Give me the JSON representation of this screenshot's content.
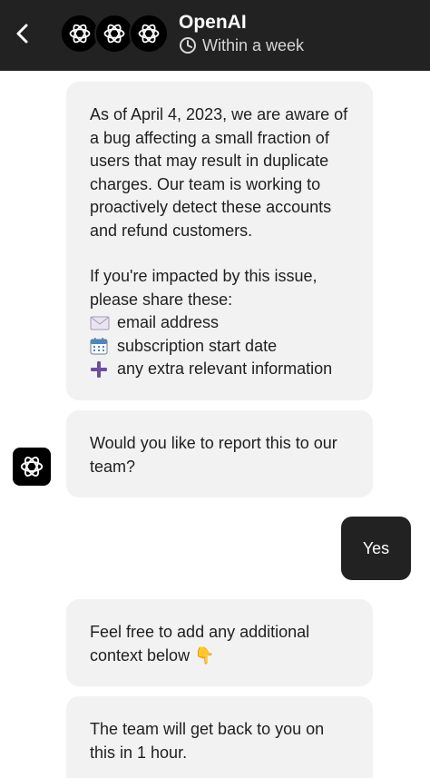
{
  "header": {
    "title": "OpenAI",
    "status": "Within a week",
    "back_icon": "chevron-left-icon",
    "status_icon": "clock-icon",
    "avatar_icon": "openai-logo-icon",
    "bg_color": "#222222"
  },
  "messages": {
    "m1": {
      "intro": "As of April 4, 2023, we are aware of a bug affecting a small fraction of users that may result in duplicate charges. Our team is working to proactively detect these accounts and refund customers.",
      "ask": "If you're impacted by this issue, please share these:",
      "items": [
        {
          "icon": "envelope-icon",
          "text": "email address"
        },
        {
          "icon": "calendar-icon",
          "text": "subscription start date"
        },
        {
          "icon": "plus-icon",
          "text": "any extra relevant information"
        }
      ]
    },
    "m2": {
      "text": "Would you like to report this to our team?"
    },
    "user_reply": {
      "text": "Yes"
    },
    "m3": {
      "text": "Feel free to add any additional context below 👇"
    },
    "m4": {
      "text": "The team will get back to you on this in 1 hour."
    }
  },
  "colors": {
    "bubble_bg": "#f2f2f2",
    "user_bubble_bg": "#222222",
    "accent_plus": "#6b4f9e"
  }
}
